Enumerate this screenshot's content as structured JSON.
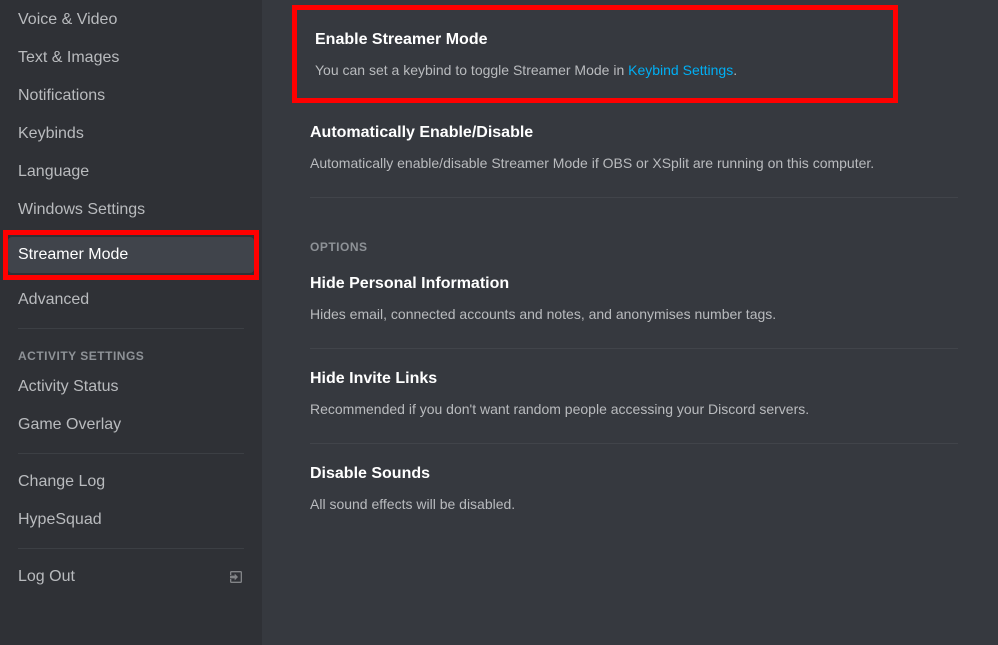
{
  "sidebar": {
    "items": [
      {
        "label": "Voice & Video"
      },
      {
        "label": "Text & Images"
      },
      {
        "label": "Notifications"
      },
      {
        "label": "Keybinds"
      },
      {
        "label": "Language"
      },
      {
        "label": "Windows Settings"
      },
      {
        "label": "Streamer Mode"
      },
      {
        "label": "Advanced"
      }
    ],
    "activity_header": "Activity Settings",
    "activity_items": [
      {
        "label": "Activity Status"
      },
      {
        "label": "Game Overlay"
      }
    ],
    "footer_items": [
      {
        "label": "Change Log"
      },
      {
        "label": "HypeSquad"
      }
    ],
    "logout_label": "Log Out"
  },
  "main": {
    "enable": {
      "title": "Enable Streamer Mode",
      "desc_prefix": "You can set a keybind to toggle Streamer Mode in ",
      "link": "Keybind Settings",
      "desc_suffix": "."
    },
    "auto": {
      "title": "Automatically Enable/Disable",
      "desc": "Automatically enable/disable Streamer Mode if OBS or XSplit are running on this computer."
    },
    "options_header": "Options",
    "hide_info": {
      "title": "Hide Personal Information",
      "desc": "Hides email, connected accounts and notes, and anonymises number tags."
    },
    "hide_invite": {
      "title": "Hide Invite Links",
      "desc": "Recommended if you don't want random people accessing your Discord servers."
    },
    "disable_sounds": {
      "title": "Disable Sounds",
      "desc": "All sound effects will be disabled."
    }
  }
}
